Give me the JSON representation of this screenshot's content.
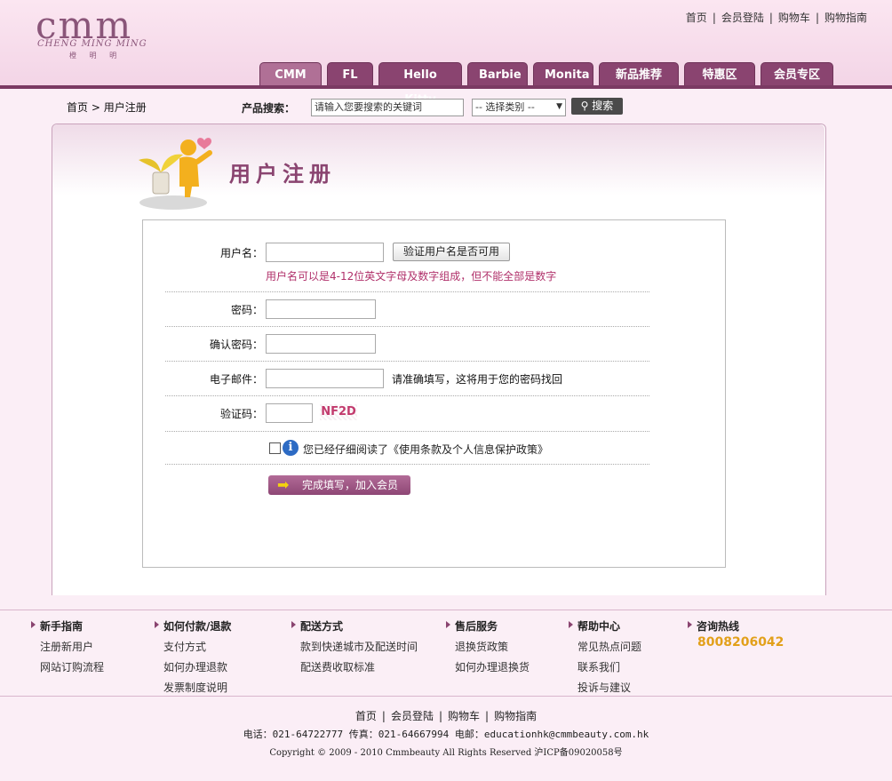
{
  "logo": {
    "main": "cmm",
    "sub": "CHENG MING MING",
    "cn": "橙 明 明"
  },
  "top_links": [
    "首页",
    "会员登陆",
    "购物车",
    "购物指南"
  ],
  "nav_tabs": [
    "CMM",
    "FL",
    "Hello Kitty",
    "Barbie",
    "Monita",
    "新品推荐",
    "特惠区",
    "会员专区"
  ],
  "breadcrumb": {
    "home": "首页",
    "sep": ">",
    "current": "用户注册"
  },
  "search": {
    "label": "产品搜索：",
    "input_value": "请输入您要搜索的关键词",
    "category": "-- 选择类别 --",
    "button": "搜索"
  },
  "page_title": "用户注册",
  "form": {
    "username_label": "用户名：",
    "check_button": "验证用户名是否可用",
    "username_hint": "用户名可以是4-12位英文字母及数字组成，但不能全部是数字",
    "password_label": "密码：",
    "confirm_label": "确认密码：",
    "email_label": "电子邮件：",
    "email_hint": "请准确填写，这将用于您的密码找回",
    "captcha_label": "验证码：",
    "captcha_text": "NF2D",
    "agree_text": "您已经仔细阅读了《使用条款及个人信息保护政策》",
    "submit": "完成填写，加入会员"
  },
  "footer": {
    "columns": [
      {
        "title": "新手指南",
        "items": [
          "注册新用户",
          "网站订购流程"
        ]
      },
      {
        "title": "如何付款/退款",
        "items": [
          "支付方式",
          "如何办理退款",
          "发票制度说明"
        ]
      },
      {
        "title": "配送方式",
        "items": [
          "款到快递城市及配送时间",
          "配送费收取标准"
        ]
      },
      {
        "title": "售后服务",
        "items": [
          "退换货政策",
          "如何办理退换货"
        ]
      },
      {
        "title": "帮助中心",
        "items": [
          "常见热点问题",
          "联系我们",
          "投诉与建议"
        ]
      },
      {
        "title": "咨询热线",
        "items": []
      }
    ],
    "hotline": "8008206042",
    "bottom_links": [
      "首页",
      "会员登陆",
      "购物车",
      "购物指南"
    ],
    "contact": "电话：021-64722777 传真：021-64667994 电邮：educationhk@cmmbeauty.com.hk",
    "copyright": "Copyright © 2009 - 2010 Cmmbeauty All Rights Reserved 沪ICP备09020058号"
  }
}
